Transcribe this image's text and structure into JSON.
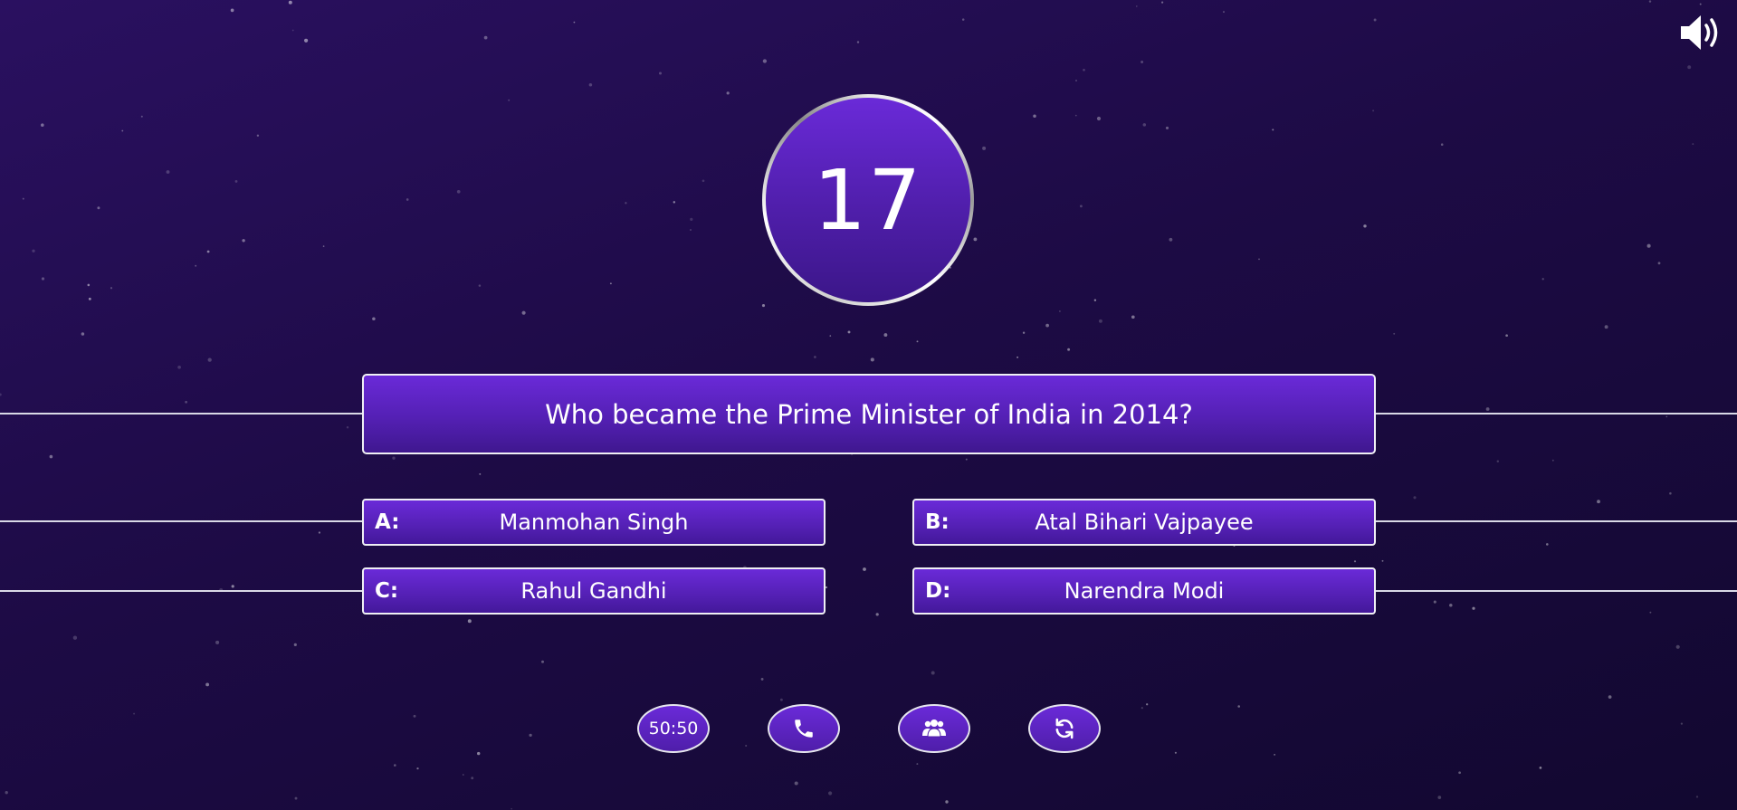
{
  "timer": {
    "value": "17"
  },
  "question": {
    "text": "Who became the Prime Minister of India in 2014?"
  },
  "answers": [
    {
      "letter": "A:",
      "text": "Manmohan Singh"
    },
    {
      "letter": "B:",
      "text": "Atal Bihari Vajpayee"
    },
    {
      "letter": "C:",
      "text": "Rahul Gandhi"
    },
    {
      "letter": "D:",
      "text": "Narendra Modi"
    }
  ],
  "lifelines": [
    {
      "label": "50:50",
      "icon": "fifty-fifty"
    },
    {
      "icon": "phone-icon"
    },
    {
      "icon": "audience-icon"
    },
    {
      "icon": "swap-question-icon"
    }
  ],
  "controls": {
    "sound_icon": "speaker-icon"
  },
  "colors": {
    "background": "#1d0b45",
    "accent_purple": "#6a2ad8",
    "border": "#f0f0f5"
  }
}
